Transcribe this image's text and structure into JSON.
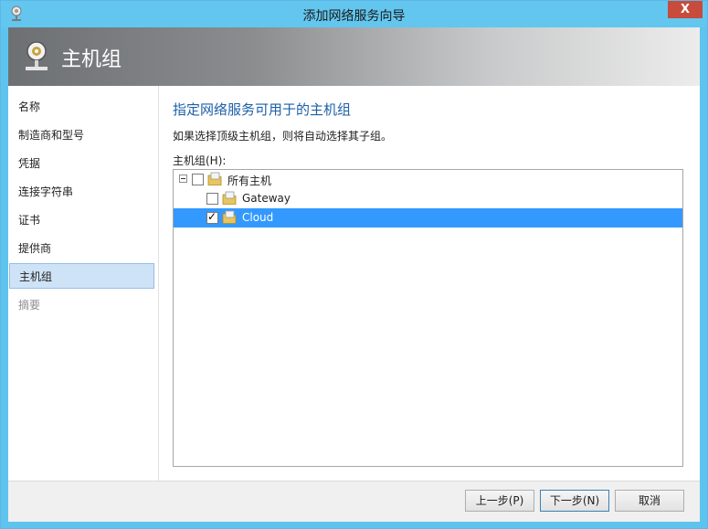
{
  "window": {
    "title": "添加网络服务向导",
    "close_label": "X"
  },
  "banner": {
    "title": "主机组"
  },
  "nav": {
    "items": [
      {
        "label": "名称"
      },
      {
        "label": "制造商和型号"
      },
      {
        "label": "凭据"
      },
      {
        "label": "连接字符串"
      },
      {
        "label": "证书"
      },
      {
        "label": "提供商"
      },
      {
        "label": "主机组"
      },
      {
        "label": "摘要"
      }
    ],
    "active_index": 6
  },
  "main": {
    "heading": "指定网络服务可用于的主机组",
    "description": "如果选择顶级主机组，则将自动选择其子组。",
    "tree_label": "主机组(H):",
    "tree": [
      {
        "label": "所有主机",
        "checked": false
      },
      {
        "label": "Gateway",
        "checked": false
      },
      {
        "label": "Cloud",
        "checked": true
      }
    ],
    "check_glyph": "✓"
  },
  "footer": {
    "back_label": "上一步(P)",
    "next_label": "下一步(N)",
    "cancel_label": "取消"
  },
  "colors": {
    "title_bar": "#62c6ef",
    "heading": "#1c5fa8",
    "selection": "#3399ff",
    "close": "#c74c3c"
  }
}
